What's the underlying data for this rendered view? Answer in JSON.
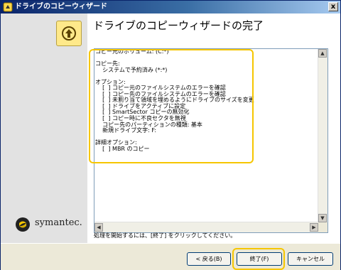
{
  "window": {
    "title": "ドライブのコピーウィザード",
    "close_label": "x"
  },
  "header": {
    "page_title": "ドライブのコピーウィザードの完了"
  },
  "summary": {
    "lines": [
      "コピー元のボリューム: (C:*)",
      "",
      "コピー先:",
      "    システムで予約済み (*:*)",
      "",
      "オプション:",
      "    [  ] コピー元のファイルシステムのエラーを確認",
      "    [  ] コピー先のファイルシステムのエラーを確認",
      "    [  ] 未割り当て領域を埋めるようにドライブのサイズを変更",
      "    [  ] ドライブをアクティブに設定",
      "    [  ] SmartSector コピーの無効化",
      "    [  ] コピー時に不良セクタを無視",
      "    コピー先のパーティションの種類: 基本",
      "    新規ドライブ文字: F:",
      "",
      "詳細オプション:",
      "    [  ] MBR のコピー"
    ]
  },
  "hint": "処理を開始するには、[終了] をクリックしてください。",
  "buttons": {
    "back": "< 戻る(B)",
    "finish": "終了(F)",
    "cancel": "キャンセル"
  },
  "brand": {
    "name": "symantec."
  },
  "colors": {
    "highlight": "#f6c600",
    "titlebar": "#0a246a"
  }
}
